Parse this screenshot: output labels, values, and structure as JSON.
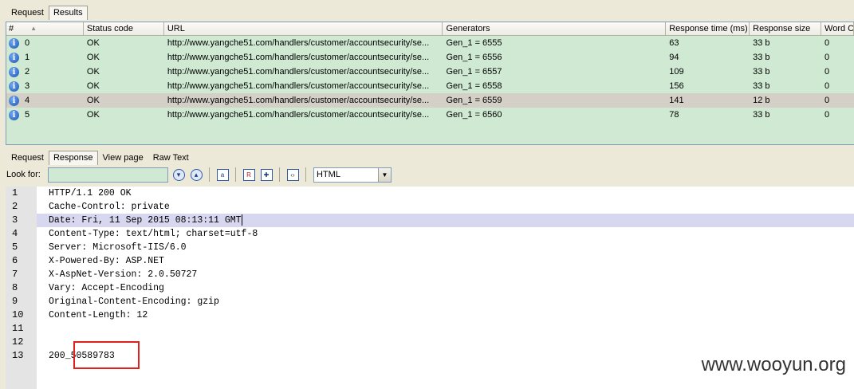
{
  "top_tabs": [
    {
      "label": "Request",
      "active": false
    },
    {
      "label": "Results",
      "active": true
    }
  ],
  "results_table": {
    "columns": [
      "#",
      "Status code",
      "URL",
      "Generators",
      "Response time (ms)",
      "Response size",
      "Word C"
    ],
    "sort_indicator": "▲",
    "rows": [
      {
        "num": "0",
        "status": "OK",
        "url": "http://www.yangche51.com/handlers/customer/accountsecurity/se...",
        "generator": "Gen_1 = 6555",
        "time": "63",
        "size": "33 b",
        "words": "0",
        "selected": false
      },
      {
        "num": "1",
        "status": "OK",
        "url": "http://www.yangche51.com/handlers/customer/accountsecurity/se...",
        "generator": "Gen_1 = 6556",
        "time": "94",
        "size": "33 b",
        "words": "0",
        "selected": false
      },
      {
        "num": "2",
        "status": "OK",
        "url": "http://www.yangche51.com/handlers/customer/accountsecurity/se...",
        "generator": "Gen_1 = 6557",
        "time": "109",
        "size": "33 b",
        "words": "0",
        "selected": false
      },
      {
        "num": "3",
        "status": "OK",
        "url": "http://www.yangche51.com/handlers/customer/accountsecurity/se...",
        "generator": "Gen_1 = 6558",
        "time": "156",
        "size": "33 b",
        "words": "0",
        "selected": false
      },
      {
        "num": "4",
        "status": "OK",
        "url": "http://www.yangche51.com/handlers/customer/accountsecurity/se...",
        "generator": "Gen_1 = 6559",
        "time": "141",
        "size": "12 b",
        "words": "0",
        "selected": true
      },
      {
        "num": "5",
        "status": "OK",
        "url": "http://www.yangche51.com/handlers/customer/accountsecurity/se...",
        "generator": "Gen_1 = 6560",
        "time": "78",
        "size": "33 b",
        "words": "0",
        "selected": false
      }
    ]
  },
  "bottom_tabs": [
    {
      "label": "Request",
      "active": false
    },
    {
      "label": "Response",
      "active": true
    },
    {
      "label": "View page",
      "active": false
    },
    {
      "label": "Raw Text",
      "active": false
    }
  ],
  "toolbar": {
    "look_for_label": "Look for:",
    "look_for_value": "",
    "format_value": "HTML"
  },
  "response_lines": [
    "HTTP/1.1 200 OK",
    "Cache-Control: private",
    "Date: Fri, 11 Sep 2015 08:13:11 GMT",
    "Content-Type: text/html; charset=utf-8",
    "Server: Microsoft-IIS/6.0",
    "X-Powered-By: ASP.NET",
    "X-AspNet-Version: 2.0.50727",
    "Vary: Accept-Encoding",
    "Original-Content-Encoding: gzip",
    "Content-Length: 12",
    "",
    "",
    "200_50589783"
  ],
  "line_numbers": [
    "1",
    "2",
    "3",
    "4",
    "5",
    "6",
    "7",
    "8",
    "9",
    "10",
    "11",
    "12",
    "13"
  ],
  "current_line": 3,
  "watermark": "www.wooyun.org",
  "colors": {
    "grid_background": "#cfe9d2",
    "selected_row": "#d4d0c8",
    "current_line": "#d7d8f0",
    "highlight_box": "#e0201a"
  }
}
